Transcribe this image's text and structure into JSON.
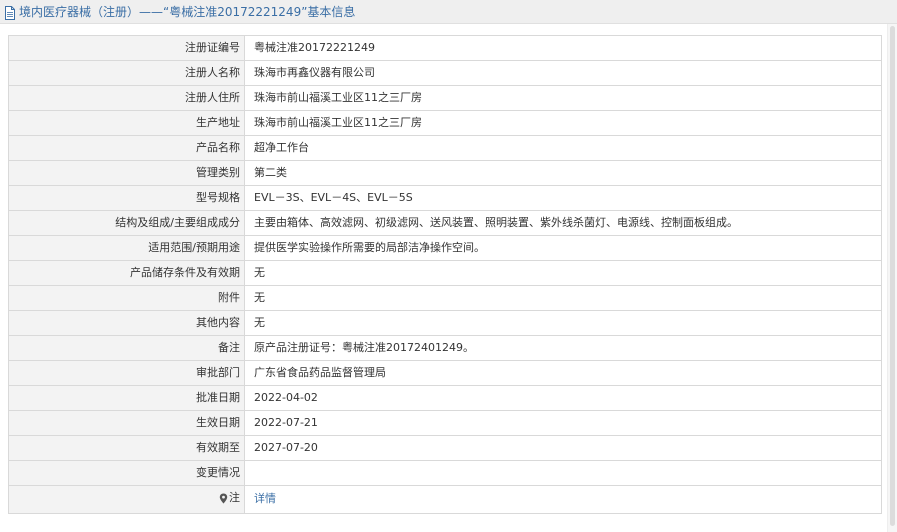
{
  "header": {
    "title": "境内医疗器械（注册）——“粤械注准20172221249”基本信息",
    "icon": "document-icon"
  },
  "rows": [
    {
      "label": "注册证编号",
      "value": "粤械注准20172221249"
    },
    {
      "label": "注册人名称",
      "value": "珠海市再鑫仪器有限公司"
    },
    {
      "label": "注册人住所",
      "value": "珠海市前山福溪工业区11之三厂房"
    },
    {
      "label": "生产地址",
      "value": "珠海市前山福溪工业区11之三厂房"
    },
    {
      "label": "产品名称",
      "value": "超净工作台"
    },
    {
      "label": "管理类别",
      "value": "第二类"
    },
    {
      "label": "型号规格",
      "value": "EVL－3S、EVL－4S、EVL－5S"
    },
    {
      "label": "结构及组成/主要组成成分",
      "value": "主要由箱体、高效滤网、初级滤网、送风装置、照明装置、紫外线杀菌灯、电源线、控制面板组成。"
    },
    {
      "label": "适用范围/预期用途",
      "value": "提供医学实验操作所需要的局部洁净操作空间。"
    },
    {
      "label": "产品储存条件及有效期",
      "value": "无"
    },
    {
      "label": "附件",
      "value": "无"
    },
    {
      "label": "其他内容",
      "value": "无"
    },
    {
      "label": "备注",
      "value": "原产品注册证号：粤械注准20172401249。"
    },
    {
      "label": "审批部门",
      "value": "广东省食品药品监督管理局"
    },
    {
      "label": "批准日期",
      "value": "2022-04-02"
    },
    {
      "label": "生效日期",
      "value": "2022-07-21"
    },
    {
      "label": "有效期至",
      "value": "2027-07-20"
    },
    {
      "label": "变更情况",
      "value": ""
    }
  ],
  "note": {
    "label": "注",
    "icon": "location-pin-icon",
    "link_text": "详情"
  },
  "colors": {
    "title_text": "#3a6ea5",
    "label_bg": "#f3f3f3",
    "border": "#d9d9d9",
    "link": "#3a6ea5"
  }
}
